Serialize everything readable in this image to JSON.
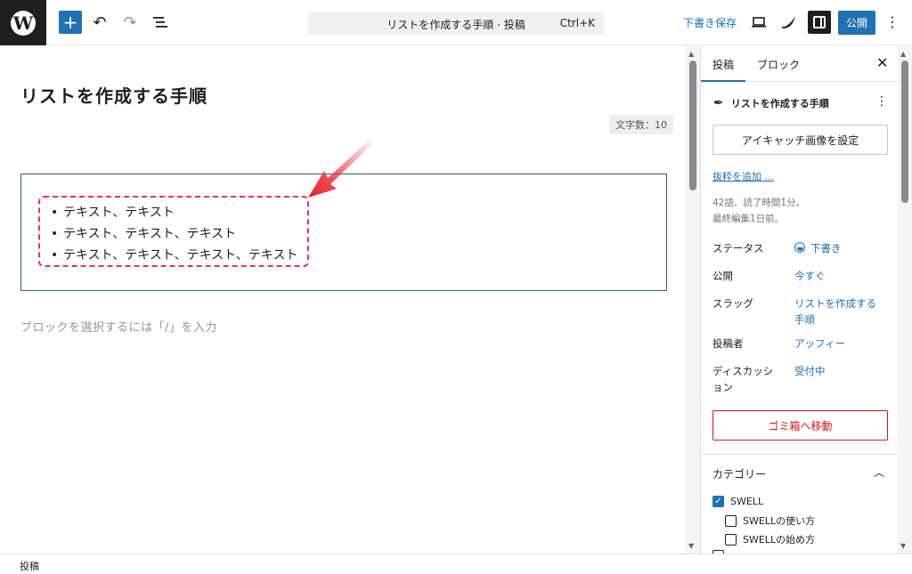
{
  "topbar": {
    "logo_text": "W",
    "add_icon": "plus-icon",
    "undo_icon": "undo-icon",
    "redo_icon": "redo-icon",
    "outline_icon": "list-view-icon",
    "command_title": "リストを作成する手順 · 投稿",
    "command_shortcut": "Ctrl+K",
    "save_draft": "下書き保存",
    "preview_icon": "laptop-preview-icon",
    "theme_icon": "swell-logo-icon",
    "sidebar_icon": "sidebar-toggle-icon",
    "publish": "公開",
    "options_icon": "vertical-dots-icon"
  },
  "editor": {
    "title": "リストを作成する手順",
    "word_count": "文字数：10",
    "list_items": [
      "テキスト、テキスト",
      "テキスト、テキスト、テキスト",
      "テキスト、テキスト、テキスト、テキスト"
    ],
    "placeholder": "ブロックを選択するには「/」を入力",
    "annotation_color": "#e2336b"
  },
  "sidebar": {
    "tabs": [
      "投稿",
      "ブロック"
    ],
    "close_icon": "close-icon",
    "post_title": "リストを作成する手順",
    "featured_image_btn": "アイキャッチ画像を設定",
    "excerpt_link": "抜粋を追加 ...",
    "meta_line1": "42語、読了時間1分。",
    "meta_line2": "最終編集1日前。",
    "rows": [
      {
        "label": "ステータス",
        "value": "下書き"
      },
      {
        "label": "公開",
        "value": "今すぐ"
      },
      {
        "label": "スラッグ",
        "value": "リストを作成する手順"
      },
      {
        "label": "投稿者",
        "value": "アッフィー"
      },
      {
        "label": "ディスカッション",
        "value": "受付中"
      }
    ],
    "trash_btn": "ゴミ箱へ移動",
    "category_title": "カテゴリー",
    "categories": [
      {
        "name": "SWELL",
        "checked": true
      },
      {
        "name": "SWELLの使い方",
        "checked": false
      },
      {
        "name": "SWELLの始め方",
        "checked": false
      }
    ]
  },
  "footer": {
    "breadcrumb": "投稿"
  },
  "colors": {
    "accent": "#2271b1",
    "danger": "#cc1818",
    "highlight": "#e2336b"
  }
}
